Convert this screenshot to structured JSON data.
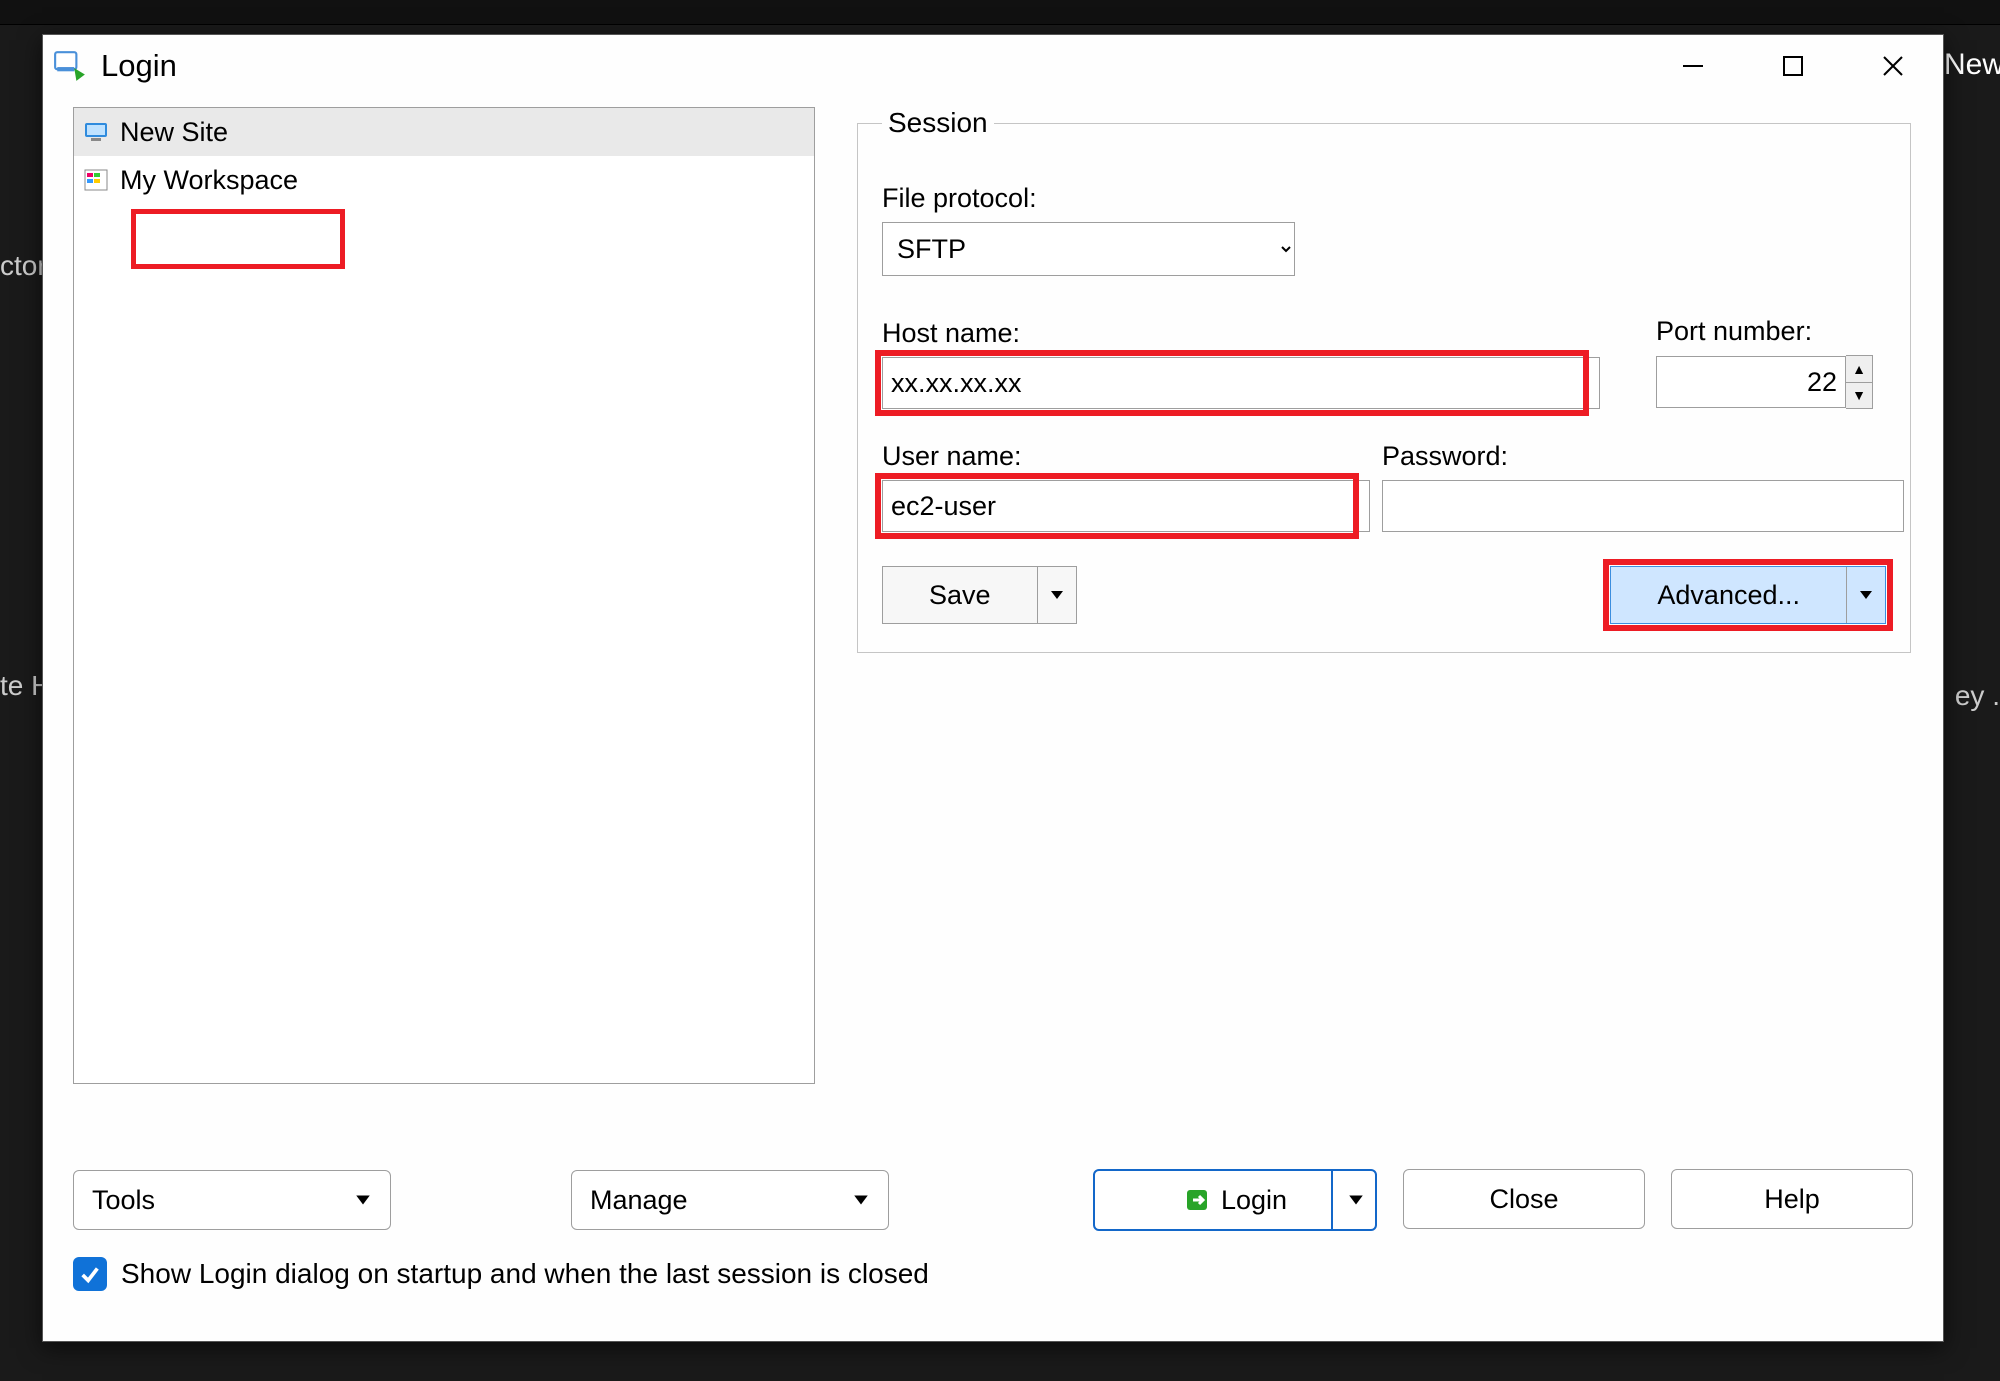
{
  "window": {
    "title": "Login"
  },
  "tree": {
    "items": [
      {
        "label": "New Site",
        "selected": true
      },
      {
        "label": "My Workspace",
        "selected": false
      }
    ]
  },
  "session": {
    "legend": "Session",
    "protocol_label": "File protocol:",
    "protocol_value": "SFTP",
    "host_label": "Host name:",
    "host_value": "xx.xx.xx.xx",
    "port_label": "Port number:",
    "port_value": "22",
    "user_label": "User name:",
    "user_value": "ec2-user",
    "pass_label": "Password:",
    "pass_value": "",
    "save_label": "Save",
    "advanced_label": "Advanced..."
  },
  "buttons": {
    "tools": "Tools",
    "manage": "Manage",
    "login": "Login",
    "close": "Close",
    "help": "Help"
  },
  "checkbox": {
    "label": "Show Login dialog on startup and when the last session is closed",
    "checked": true
  },
  "bg": {
    "new_tab": "New",
    "left1": "ctor",
    "left2": "te H",
    "right1": "ey ."
  }
}
